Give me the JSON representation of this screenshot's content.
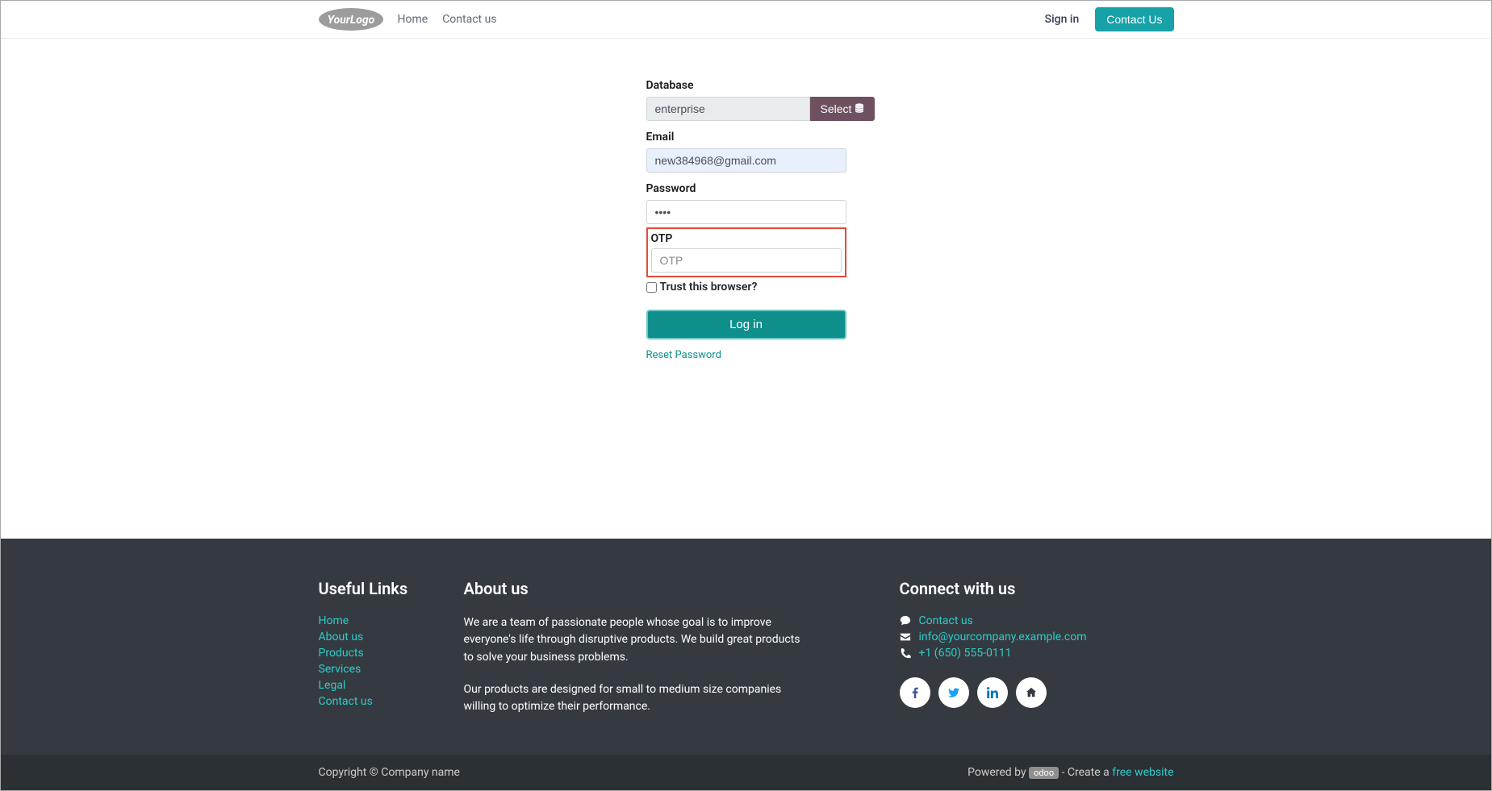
{
  "nav": {
    "logo_text": "YourLogo",
    "home": "Home",
    "contact": "Contact us",
    "signin": "Sign in",
    "contact_btn": "Contact Us"
  },
  "form": {
    "database_label": "Database",
    "database_value": "enterprise",
    "select_btn": "Select",
    "email_label": "Email",
    "email_value": "new384968@gmail.com",
    "password_label": "Password",
    "password_value": "••••",
    "otp_label": "OTP",
    "otp_placeholder": "OTP",
    "otp_value": "",
    "trust_label": "Trust this browser?",
    "trust_checked": false,
    "login_btn": "Log in",
    "reset_link": "Reset Password"
  },
  "footer": {
    "useful_heading": "Useful Links",
    "links": [
      "Home",
      "About us",
      "Products",
      "Services",
      "Legal",
      "Contact us"
    ],
    "about_heading": "About us",
    "about_p1": "We are a team of passionate people whose goal is to improve everyone's life through disruptive products. We build great products to solve your business problems.",
    "about_p2": "Our products are designed for small to medium size companies willing to optimize their performance.",
    "connect_heading": "Connect with us",
    "connect_contact": "Contact us",
    "connect_email": "info@yourcompany.example.com",
    "connect_phone": "+1 (650) 555-0111"
  },
  "subfooter": {
    "copyright": "Copyright © Company name",
    "powered_prefix": "Powered by ",
    "odoo": "odoo",
    "create_prefix": " - Create a ",
    "free_website": "free website"
  },
  "colors": {
    "teal": "#17a2a8",
    "teal_dark": "#0f8f8c",
    "footer_bg": "#343a40",
    "link_teal": "#2ecccb",
    "select_btn": "#6f5060",
    "highlight_red": "#e34b3d"
  }
}
